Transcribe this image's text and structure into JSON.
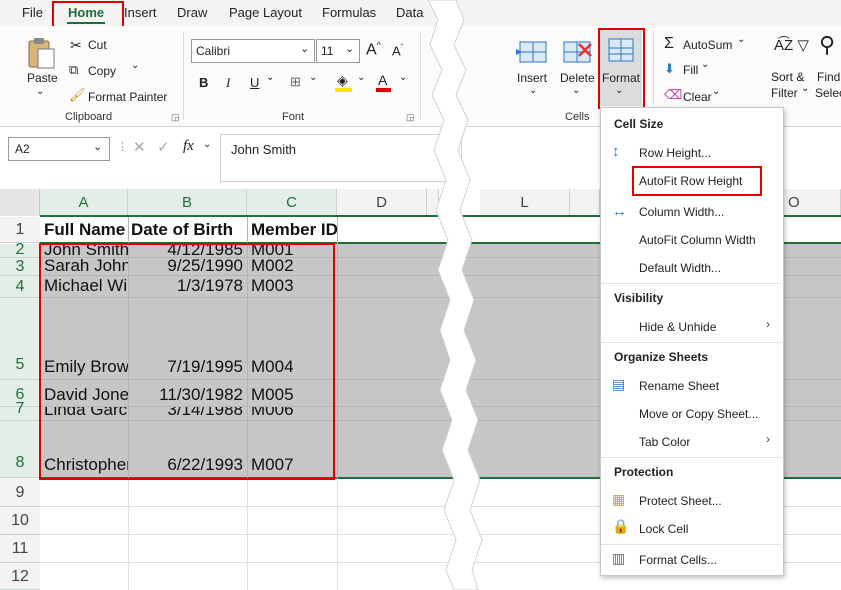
{
  "tabs": [
    "File",
    "Home",
    "Insert",
    "Draw",
    "Page Layout",
    "Formulas",
    "Data"
  ],
  "clipboard": {
    "paste": "Paste",
    "cut": "Cut",
    "copy": "Copy",
    "format_painter": "Format Painter",
    "group": "Clipboard"
  },
  "font": {
    "name": "Calibri",
    "size": "11",
    "bold": "B",
    "italic": "I",
    "underline": "U",
    "color_a": "A",
    "group": "Font"
  },
  "cells_group": {
    "insert": "Insert",
    "delete": "Delete",
    "format": "Format",
    "group": "Cells"
  },
  "editing": {
    "autosum": "AutoSum",
    "fill": "Fill",
    "clear": "Clear",
    "sort_filter_1": "Sort &",
    "sort_filter_2": "Filter",
    "find_1": "Find",
    "find_2": "Selec"
  },
  "formula_bar": {
    "name_box": "A2",
    "fx": "fx",
    "content": "John Smith"
  },
  "columns": [
    "A",
    "B",
    "C",
    "D",
    "L",
    "O"
  ],
  "rows": [
    "1",
    "2",
    "3",
    "4",
    "5",
    "6",
    "7",
    "8",
    "9",
    "10",
    "11",
    "12"
  ],
  "headers": {
    "name": "Full Name",
    "dob": "Date of Birth",
    "id": "Member ID"
  },
  "data": [
    {
      "name": "John Smith",
      "dob": "4/12/1985",
      "id": "M001"
    },
    {
      "name": "Sarah Johnson",
      "dob": "9/25/1990",
      "id": "M002"
    },
    {
      "name": "Michael Williams",
      "dob": "1/3/1978",
      "id": "M003"
    },
    {
      "name": "Emily Brown",
      "dob": "7/19/1995",
      "id": "M004"
    },
    {
      "name": "David Jones",
      "dob": "11/30/1982",
      "id": "M005"
    },
    {
      "name": "Linda Garcia",
      "dob": "3/14/1988",
      "id": "M006"
    },
    {
      "name": "Christopher",
      "dob": "6/22/1993",
      "id": "M007"
    }
  ],
  "menu": {
    "cell_size": "Cell Size",
    "row_height": "Row Height...",
    "autofit_row": "AutoFit Row Height",
    "column_width": "Column Width...",
    "autofit_column": "AutoFit Column Width",
    "default_width": "Default Width...",
    "visibility": "Visibility",
    "hide_unhide": "Hide & Unhide",
    "organize": "Organize Sheets",
    "rename": "Rename Sheet",
    "move_copy": "Move or Copy Sheet...",
    "tab_color": "Tab Color",
    "protection": "Protection",
    "protect_sheet": "Protect Sheet...",
    "lock_cell": "Lock Cell",
    "format_cells": "Format Cells..."
  },
  "colors": {
    "accent_red": "#e00000",
    "excel_green": "#216e3a",
    "selection_gray": "#c6c6c6",
    "header_green": "#e3efe6"
  }
}
